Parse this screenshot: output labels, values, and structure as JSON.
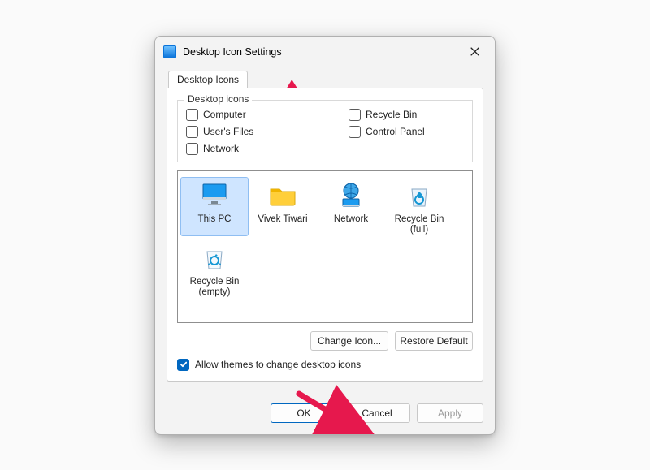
{
  "window": {
    "title": "Desktop Icon Settings"
  },
  "tab": {
    "label": "Desktop Icons"
  },
  "group": {
    "title": "Desktop icons",
    "items": {
      "computer": "Computer",
      "users_files": "User's Files",
      "network": "Network",
      "recycle_bin": "Recycle Bin",
      "control_panel": "Control Panel"
    }
  },
  "preview": {
    "this_pc": "This PC",
    "user": "Vivek Tiwari",
    "network": "Network",
    "recycle_full": "Recycle Bin (full)",
    "recycle_empty": "Recycle Bin (empty)"
  },
  "buttons": {
    "change_icon": "Change Icon...",
    "restore_default": "Restore Default",
    "ok": "OK",
    "cancel": "Cancel",
    "apply": "Apply"
  },
  "allow_themes": {
    "label": "Allow themes to change desktop icons",
    "checked": true
  }
}
